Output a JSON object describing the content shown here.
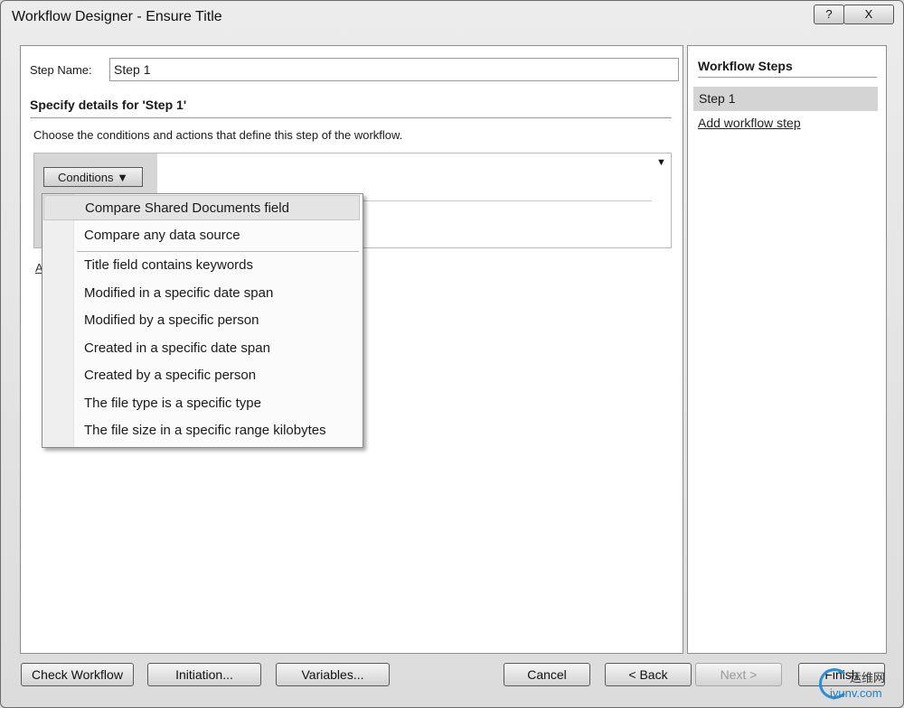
{
  "window": {
    "title": "Workflow Designer - Ensure Title",
    "help_label": "?",
    "close_label": "X"
  },
  "step": {
    "name_label": "Step Name:",
    "name_value": "Step 1",
    "details_header": "Specify details for 'Step 1'",
    "instructions": "Choose the conditions and actions that define this step of the workflow.",
    "conditions_button": "Conditions ▼",
    "rule_menu_arrow": "▼",
    "actions_partial": "A"
  },
  "conditions_menu": {
    "items": [
      "Compare Shared Documents field",
      "Compare any data source",
      "Title field contains keywords",
      "Modified in a specific date span",
      "Modified by a specific person",
      "Created in a specific date span",
      "Created by a specific person",
      "The file type is a specific type",
      "The file size in a specific range kilobytes"
    ],
    "highlighted_index": 0
  },
  "workflow_steps": {
    "title": "Workflow Steps",
    "items": [
      "Step 1"
    ],
    "add_link": "Add workflow step"
  },
  "buttons": {
    "check_workflow": "Check Workflow",
    "initiation": "Initiation...",
    "variables": "Variables...",
    "cancel": "Cancel",
    "back": "< Back",
    "next": "Next >",
    "finish": "Finish"
  },
  "watermark": {
    "top": "运维网",
    "bottom": "iyunv.com"
  }
}
